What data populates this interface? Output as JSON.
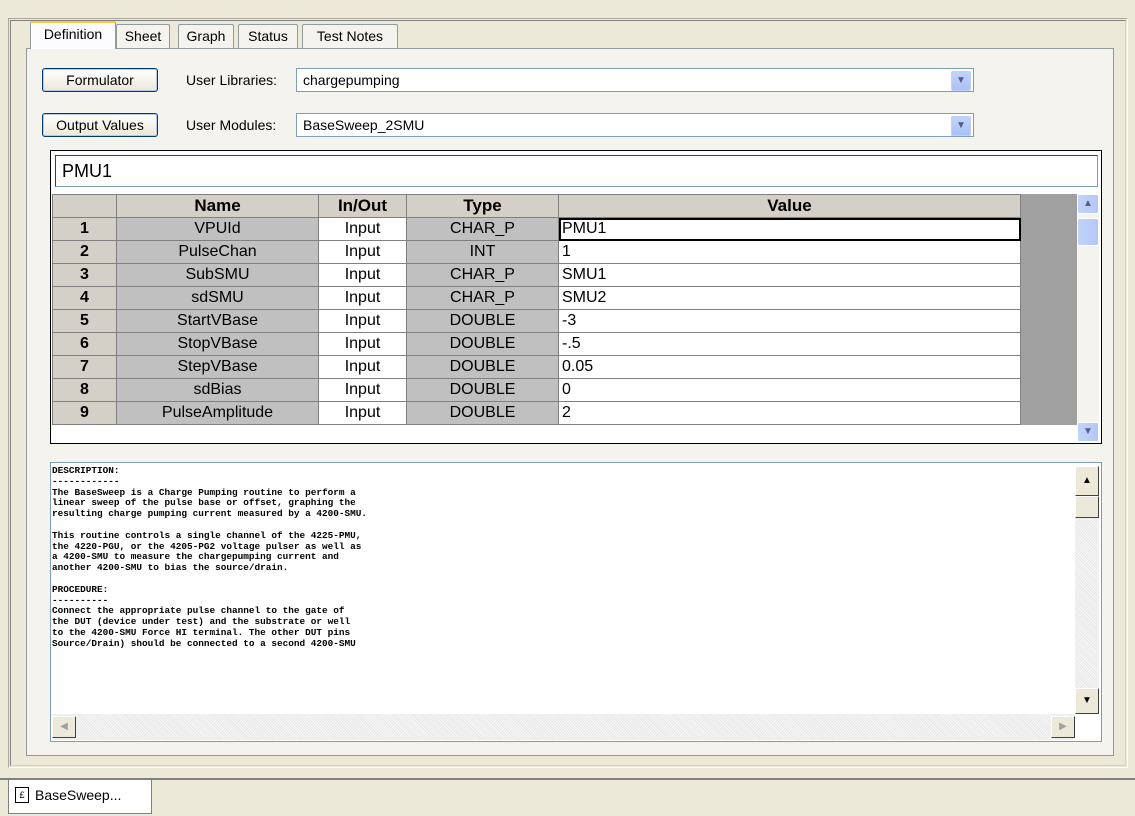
{
  "tabs": [
    "Definition",
    "Sheet",
    "Graph",
    "Status",
    "Test Notes"
  ],
  "active_tab": "Definition",
  "toolbar": {
    "formulator_label": "Formulator",
    "output_values_label": "Output Values",
    "user_libraries_label": "User Libraries:",
    "user_libraries_value": "chargepumping",
    "user_modules_label": "User Modules:",
    "user_modules_value": "BaseSweep_2SMU"
  },
  "grid": {
    "current_cell_text": "PMU1",
    "columns": [
      "Name",
      "In/Out",
      "Type",
      "Value"
    ],
    "rows": [
      {
        "num": "1",
        "name": "VPUId",
        "inout": "Input",
        "type": "CHAR_P",
        "value": "PMU1"
      },
      {
        "num": "2",
        "name": "PulseChan",
        "inout": "Input",
        "type": "INT",
        "value": "1"
      },
      {
        "num": "3",
        "name": "SubSMU",
        "inout": "Input",
        "type": "CHAR_P",
        "value": "SMU1"
      },
      {
        "num": "4",
        "name": "sdSMU",
        "inout": "Input",
        "type": "CHAR_P",
        "value": "SMU2"
      },
      {
        "num": "5",
        "name": "StartVBase",
        "inout": "Input",
        "type": "DOUBLE",
        "value": "-3"
      },
      {
        "num": "6",
        "name": "StopVBase",
        "inout": "Input",
        "type": "DOUBLE",
        "value": "-.5"
      },
      {
        "num": "7",
        "name": "StepVBase",
        "inout": "Input",
        "type": "DOUBLE",
        "value": "0.05"
      },
      {
        "num": "8",
        "name": "sdBias",
        "inout": "Input",
        "type": "DOUBLE",
        "value": "0"
      },
      {
        "num": "9",
        "name": "PulseAmplitude",
        "inout": "Input",
        "type": "DOUBLE",
        "value": "2"
      }
    ]
  },
  "description": "DESCRIPTION:\n------------\nThe BaseSweep is a Charge Pumping routine to perform a\nlinear sweep of the pulse base or offset, graphing the\nresulting charge pumping current measured by a 4200-SMU.\n\nThis routine controls a single channel of the 4225-PMU,\nthe 4220-PGU, or the 4205-PG2 voltage pulser as well as\na 4200-SMU to measure the chargepumping current and\nanother 4200-SMU to bias the source/drain.\n\nPROCEDURE:\n----------\nConnect the appropriate pulse channel to the gate of\nthe DUT (device under test) and the substrate or well\nto the 4200-SMU Force HI terminal. The other DUT pins\nSource/Drain) should be connected to a second 4200-SMU",
  "bottom_tab": {
    "label": "BaseSweep...",
    "icon": "document-icon"
  }
}
